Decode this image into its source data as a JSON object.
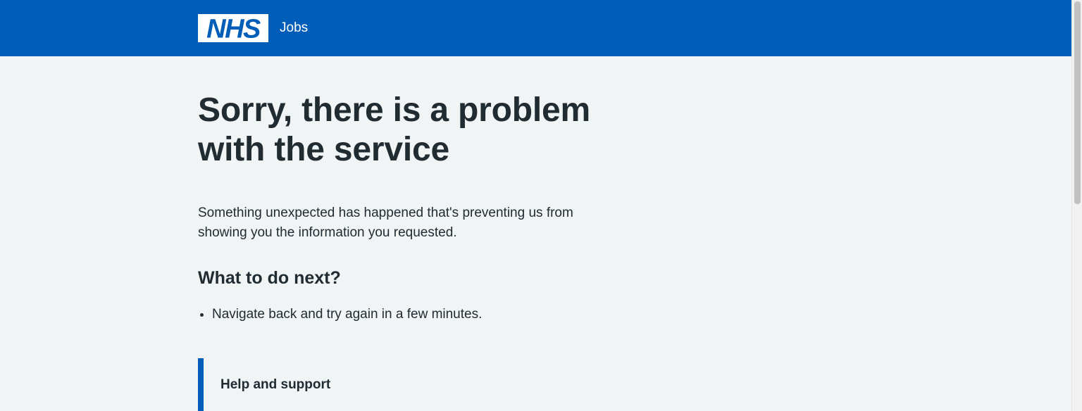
{
  "header": {
    "logo_text": "NHS",
    "service_name": "Jobs",
    "brand_color": "#005eb8"
  },
  "main": {
    "title": "Sorry, there is a problem with the service",
    "intro": "Something unexpected has happened that's preventing us from showing you the information you requested.",
    "next_heading": "What to do next?",
    "next_steps": [
      "Navigate back and try again in a few minutes."
    ],
    "help_heading": "Help and support"
  }
}
